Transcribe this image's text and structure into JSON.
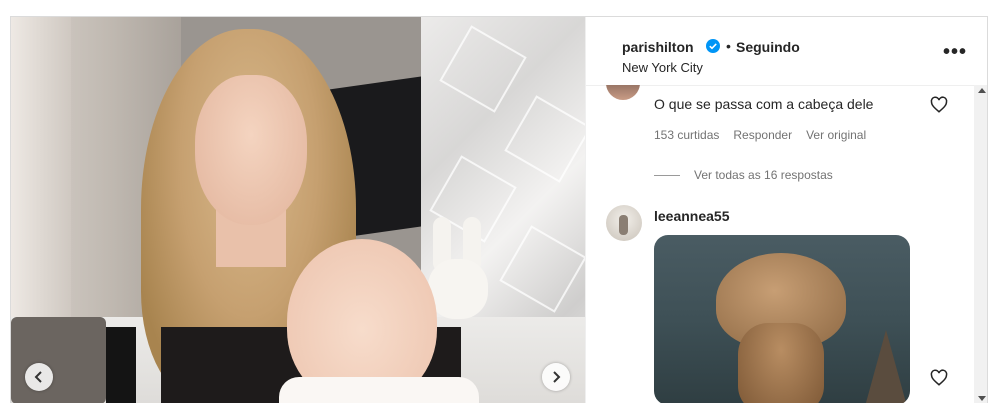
{
  "post": {
    "username": "parishilton",
    "follow_status": "Seguindo",
    "location": "New York City"
  },
  "comments": [
    {
      "text": "O que se passa com a cabeça dele",
      "likes": "153 curtidas",
      "reply_label": "Responder",
      "translate_label": "Ver original",
      "view_replies": "Ver todas as 16 respostas"
    },
    {
      "username": "leeannea55"
    }
  ],
  "icons": {
    "verified": "verified-badge-icon",
    "more": "more-options-icon",
    "heart": "heart-outline-icon",
    "prev": "chevron-left-icon",
    "next": "chevron-right-icon"
  },
  "colors": {
    "verified_blue": "#0095f6",
    "text_primary": "#262626",
    "text_secondary": "#737373"
  }
}
